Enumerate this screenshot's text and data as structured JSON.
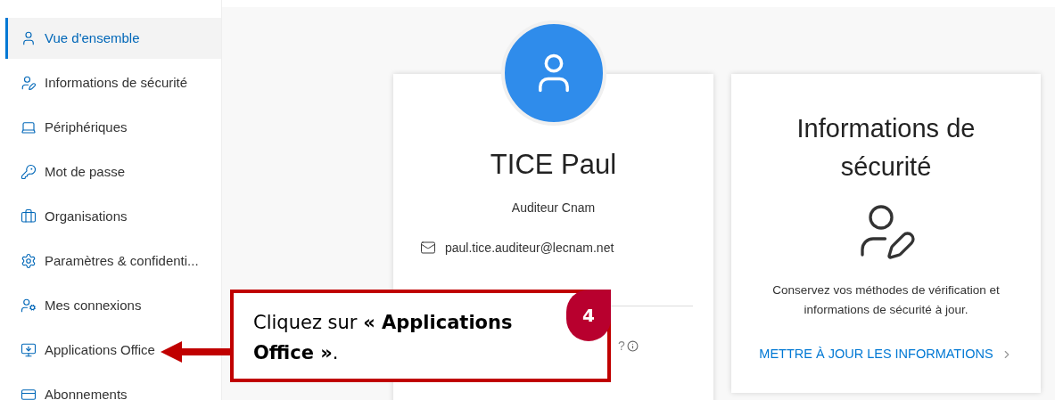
{
  "sidebar": {
    "items": [
      {
        "label": "Vue d'ensemble",
        "selected": true
      },
      {
        "label": "Informations de sécurité",
        "selected": false
      },
      {
        "label": "Périphériques",
        "selected": false
      },
      {
        "label": "Mot de passe",
        "selected": false
      },
      {
        "label": "Organisations",
        "selected": false
      },
      {
        "label": "Paramètres & confidenti...",
        "selected": false
      },
      {
        "label": "Mes connexions",
        "selected": false
      },
      {
        "label": "Applications Office",
        "selected": false
      },
      {
        "label": "Abonnements",
        "selected": false
      }
    ]
  },
  "profile_card": {
    "name": "TICE Paul",
    "role": "Auditeur Cnam",
    "email": "paul.tice.auditeur@lecnam.net",
    "partial_link": "?"
  },
  "security_card": {
    "title": "Informations de sécurité",
    "description": "Conservez vos méthodes de vérification et informations de sécurité à jour.",
    "link": "METTRE À JOUR LES INFORMATIONS"
  },
  "callout": {
    "text": "Cliquez sur **« Applications Office »**.",
    "step": "4"
  }
}
